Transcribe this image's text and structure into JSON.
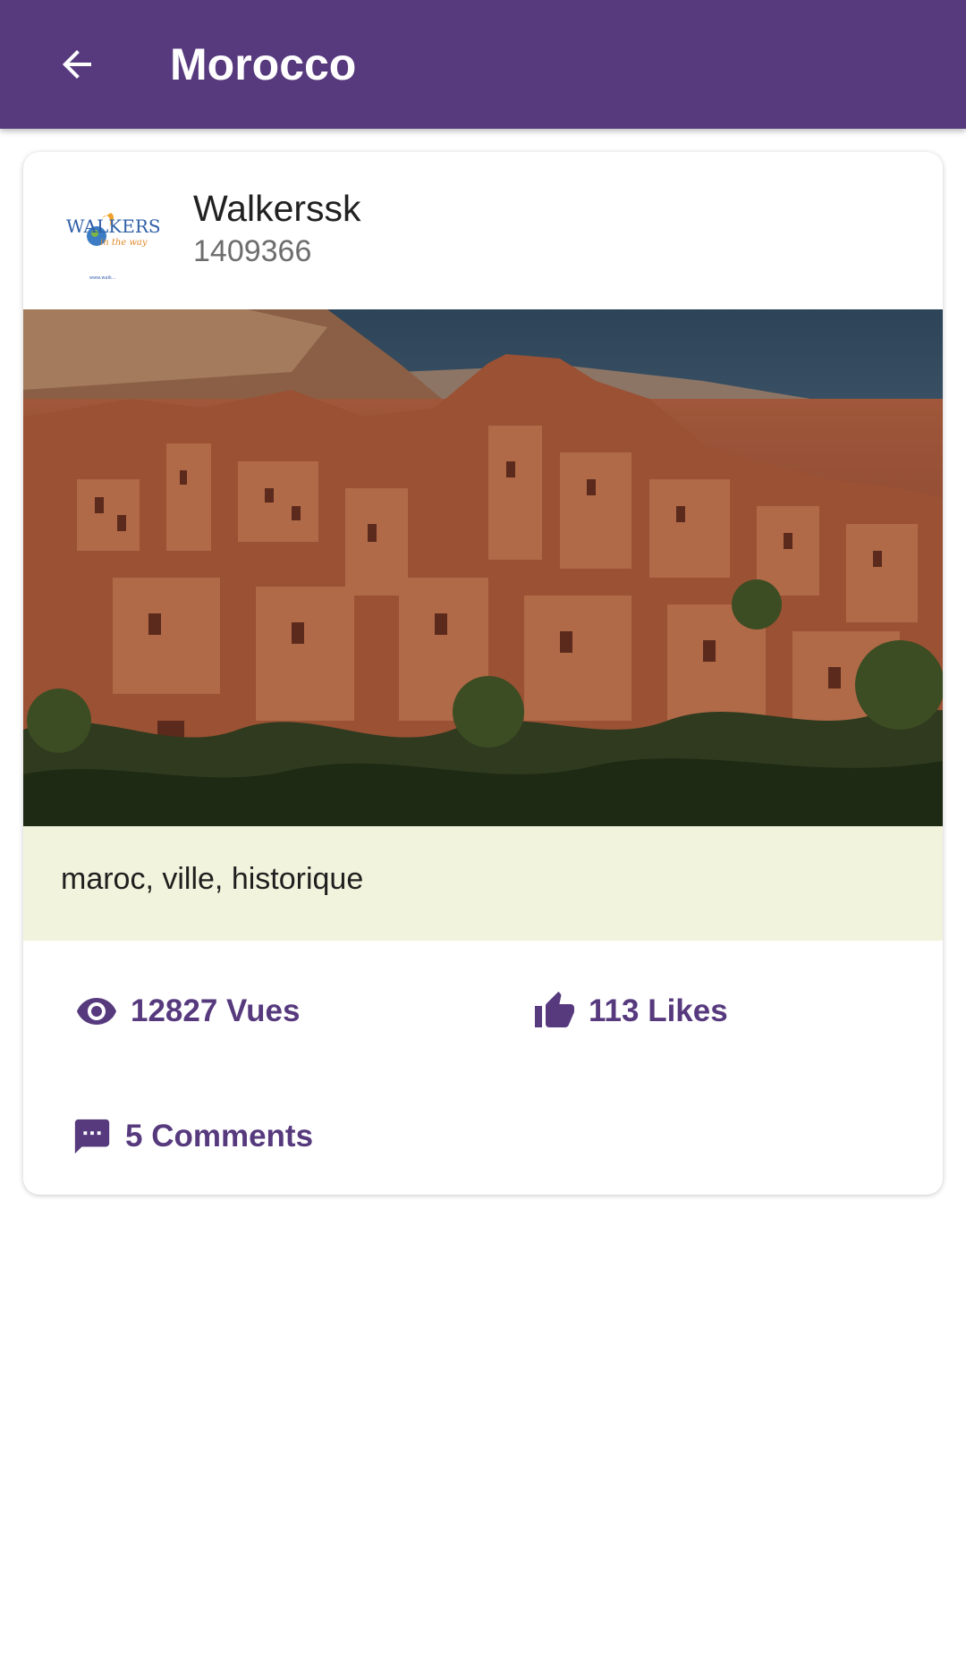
{
  "appbar": {
    "title": "Morocco",
    "back_icon": "arrow-back-icon",
    "background": "#573a7e"
  },
  "post": {
    "author": {
      "name": "Walkerssk",
      "id": "1409366",
      "logo_text": "WALKERS",
      "logo_tagline": "in the way",
      "logo_url_text": "www.walk..."
    },
    "photo_icon": "kasbah-photo",
    "tags": "maroc, ville, historique",
    "stats": {
      "views": "12827 Vues",
      "likes": "113 Likes",
      "comments": "5 Comments"
    },
    "icons": {
      "views": "eye-icon",
      "likes": "thumb-up-icon",
      "comments": "comment-icon"
    },
    "accent": "#573a7e",
    "tags_background": "#f2f3dc"
  }
}
